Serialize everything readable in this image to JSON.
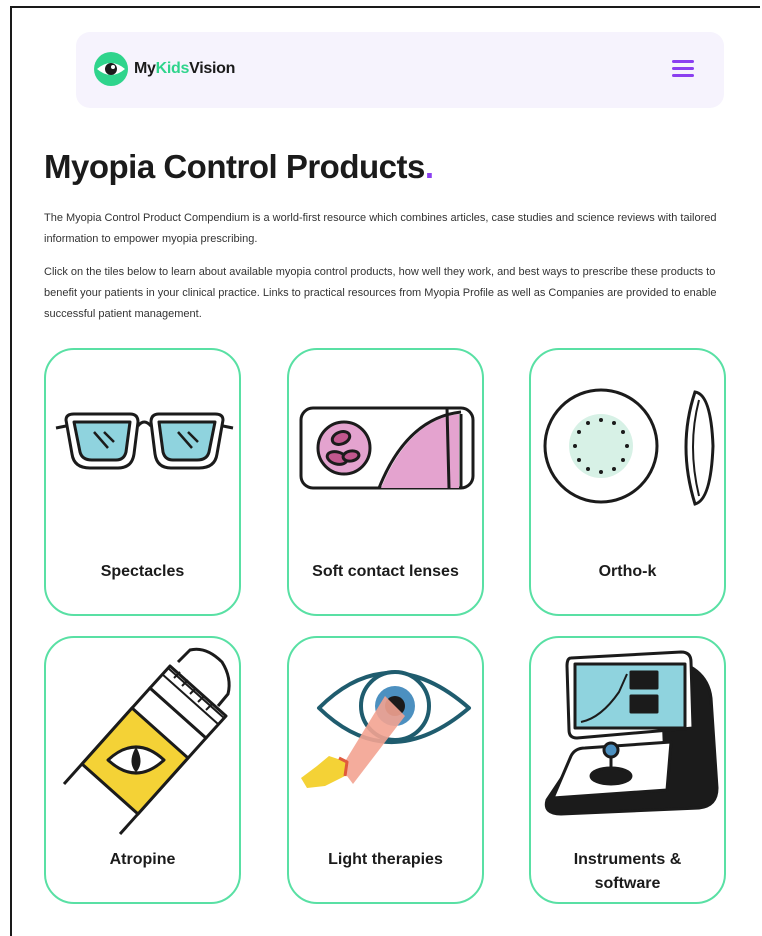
{
  "header": {
    "logo_prefix": "My",
    "logo_accent": "Kids",
    "logo_suffix": "Vision",
    "logo_icon": "eye-logo-icon",
    "menu_icon": "hamburger-menu-icon"
  },
  "page": {
    "title": "Myopia Control Products",
    "title_dot": ".",
    "intro": "The Myopia Control Product Compendium is a world-first resource which combines articles, case studies and science reviews with tailored information to empower myopia prescribing.",
    "instructions": "Click on the tiles below to learn about available myopia control products, how well they work, and best ways to prescribe these products to benefit your patients in your clinical practice. Links to practical resources from Myopia Profile as well as Companies are provided to enable successful patient management."
  },
  "tiles": [
    {
      "label": "Spectacles",
      "icon": "spectacles-icon"
    },
    {
      "label": "Soft contact lenses",
      "icon": "contact-lens-case-icon"
    },
    {
      "label": "Ortho-k",
      "icon": "ortho-k-lens-icon"
    },
    {
      "label": "Atropine",
      "icon": "eye-drop-bottle-icon"
    },
    {
      "label": "Light therapies",
      "icon": "light-therapy-eye-icon"
    },
    {
      "label": "Instruments & software",
      "icon": "instrument-machine-icon"
    }
  ],
  "colors": {
    "accent_purple": "#8b3ff0",
    "brand_green": "#2fd48c",
    "tile_border": "#59e0a4",
    "nav_background": "#f6f3fd"
  }
}
